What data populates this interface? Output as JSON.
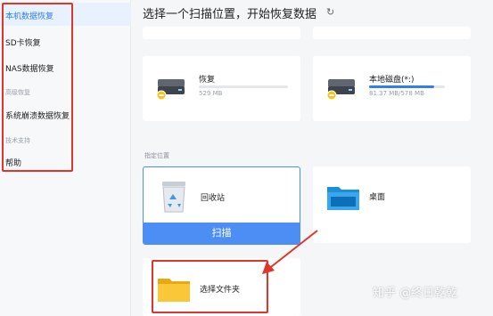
{
  "sidebar": {
    "items": [
      {
        "label": "本机数据恢复"
      },
      {
        "label": "SD卡恢复"
      },
      {
        "label": "NAS数据恢复"
      },
      {
        "label": "系统崩溃数据恢复"
      },
      {
        "label": "帮助"
      }
    ],
    "section_advanced": "高级恢复",
    "section_support": "技术支持"
  },
  "main": {
    "title": "选择一个扫描位置，开始恢复数据",
    "refresh_icon": "refresh-icon",
    "drives": [
      {
        "label": "恢复",
        "size": "529 MB",
        "progress": 0.0
      },
      {
        "label": "本地磁盘(*:)",
        "size": "81.37 MB/578 MB",
        "progress": 0.86
      }
    ],
    "section_label": "指定位置",
    "locations": [
      {
        "label": "回收站",
        "icon": "recycle-bin-icon",
        "button": "扫描"
      },
      {
        "label": "桌面",
        "icon": "desktop-folder-icon"
      },
      {
        "label": "选择文件夹",
        "icon": "folder-icon"
      }
    ]
  },
  "watermark": "知乎 @终日乾乾",
  "colors": {
    "accent": "#4d8ef5",
    "annotation": "#e0352b",
    "active_bg": "#e8f1fe"
  }
}
